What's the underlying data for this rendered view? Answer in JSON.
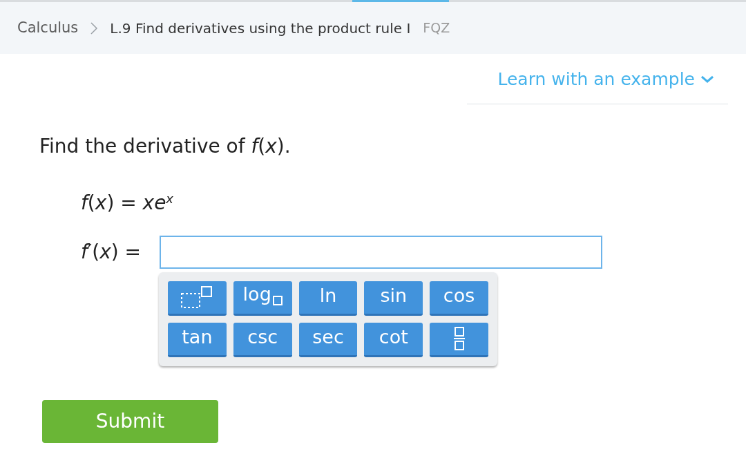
{
  "breadcrumb": {
    "subject": "Calculus",
    "skill": "L.9 Find derivatives using the product rule I",
    "code": "FQZ"
  },
  "learn_link": "Learn with an example",
  "question": {
    "prompt": "Find the derivative of *f*(*x*).",
    "function": "*f*(*x*) = *xe*$^{x}$",
    "answer_label": "*f*′(*x*) ="
  },
  "keypad": [
    [
      {
        "kind": "power"
      },
      {
        "kind": "log_base",
        "label": "log"
      },
      {
        "kind": "text",
        "label": "ln"
      },
      {
        "kind": "text",
        "label": "sin"
      },
      {
        "kind": "text",
        "label": "cos"
      }
    ],
    [
      {
        "kind": "text",
        "label": "tan"
      },
      {
        "kind": "text",
        "label": "csc"
      },
      {
        "kind": "text",
        "label": "sec"
      },
      {
        "kind": "text",
        "label": "cot"
      },
      {
        "kind": "fraction"
      }
    ]
  ],
  "submit": "Submit"
}
